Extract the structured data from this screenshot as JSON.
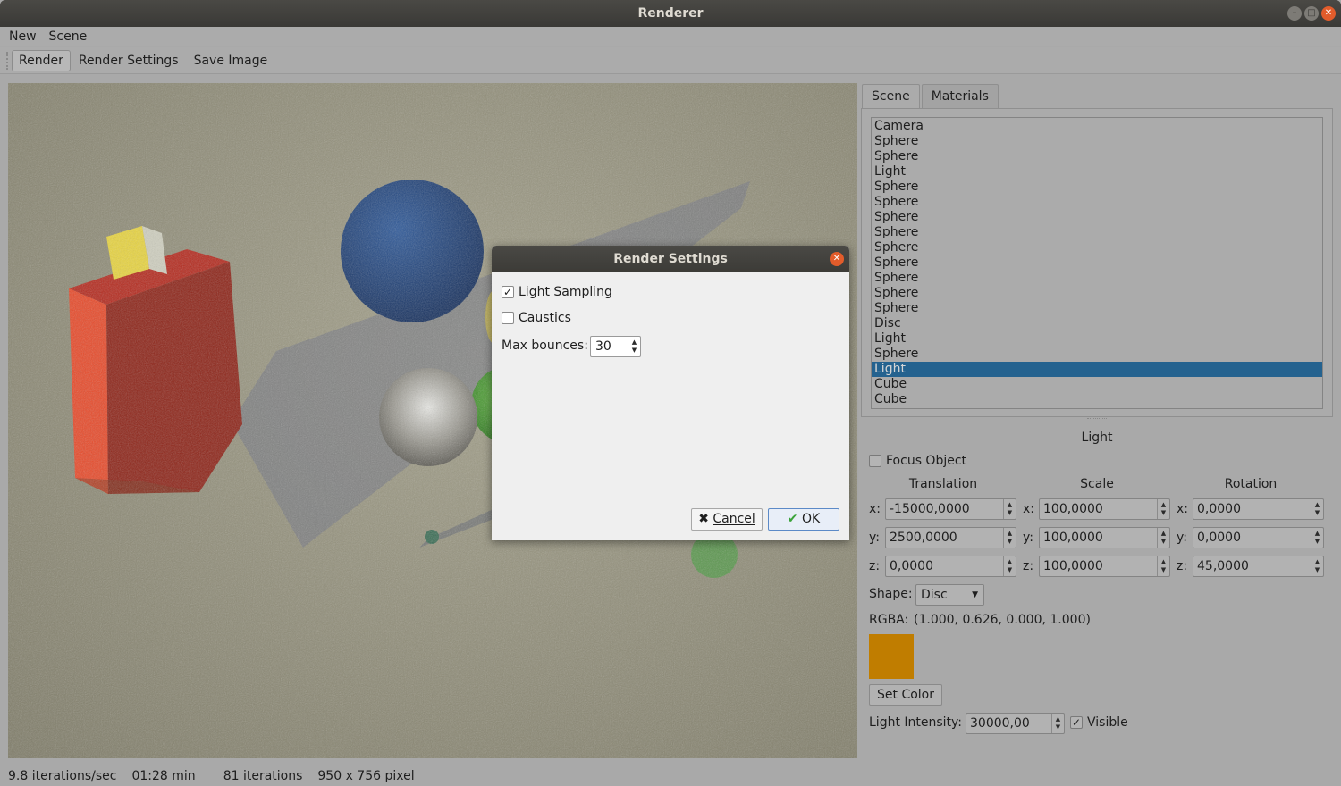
{
  "window": {
    "title": "Renderer"
  },
  "menu": {
    "items": [
      "New",
      "Scene"
    ]
  },
  "toolbar": {
    "render": "Render",
    "render_settings": "Render Settings",
    "save_image": "Save Image"
  },
  "status": {
    "rate": "9.8 iterations/sec",
    "time": "01:28 min",
    "iterations": "81 iterations",
    "size": "950 x  756 pixel"
  },
  "tabs": {
    "scene": "Scene",
    "materials": "Materials",
    "active": "Scene"
  },
  "scene_list": {
    "items": [
      "Camera",
      "Sphere",
      "Sphere",
      "Light",
      "Sphere",
      "Sphere",
      "Sphere",
      "Sphere",
      "Sphere",
      "Sphere",
      "Sphere",
      "Sphere",
      "Sphere",
      "Disc",
      "Light",
      "Sphere",
      "Light",
      "Cube",
      "Cube"
    ],
    "selected_index": 16
  },
  "properties": {
    "title": "Light",
    "focus_object_label": "Focus Object",
    "focus_object_checked": false,
    "translation_header": "Translation",
    "scale_header": "Scale",
    "rotation_header": "Rotation",
    "axes": [
      "x:",
      "y:",
      "z:"
    ],
    "translation": [
      "-15000,0000",
      "2500,0000",
      "0,0000"
    ],
    "scale": [
      "100,0000",
      "100,0000",
      "100,0000"
    ],
    "rotation": [
      "0,0000",
      "0,0000",
      "45,0000"
    ],
    "shape_label": "Shape:",
    "shape_value": "Disc",
    "rgba_label": "RGBA:",
    "rgba_value": "(1.000, 0.626, 0.000, 1.000)",
    "swatch_color": "#c07d00",
    "set_color": "Set Color",
    "intensity_label": "Light Intensity:",
    "intensity_value": "30000,00",
    "visible_label": "Visible",
    "visible_checked": true
  },
  "dialog": {
    "title": "Render Settings",
    "light_sampling_label": "Light Sampling",
    "light_sampling_checked": true,
    "caustics_label": "Caustics",
    "caustics_checked": false,
    "max_bounces_label": "Max bounces:",
    "max_bounces_value": "30",
    "cancel": "Cancel",
    "ok": "OK"
  },
  "icons": {
    "close": "close-icon",
    "minimize": "minimize-icon",
    "maximize": "maximize-icon",
    "check": "checkmark-icon",
    "cancel": "x-icon"
  }
}
